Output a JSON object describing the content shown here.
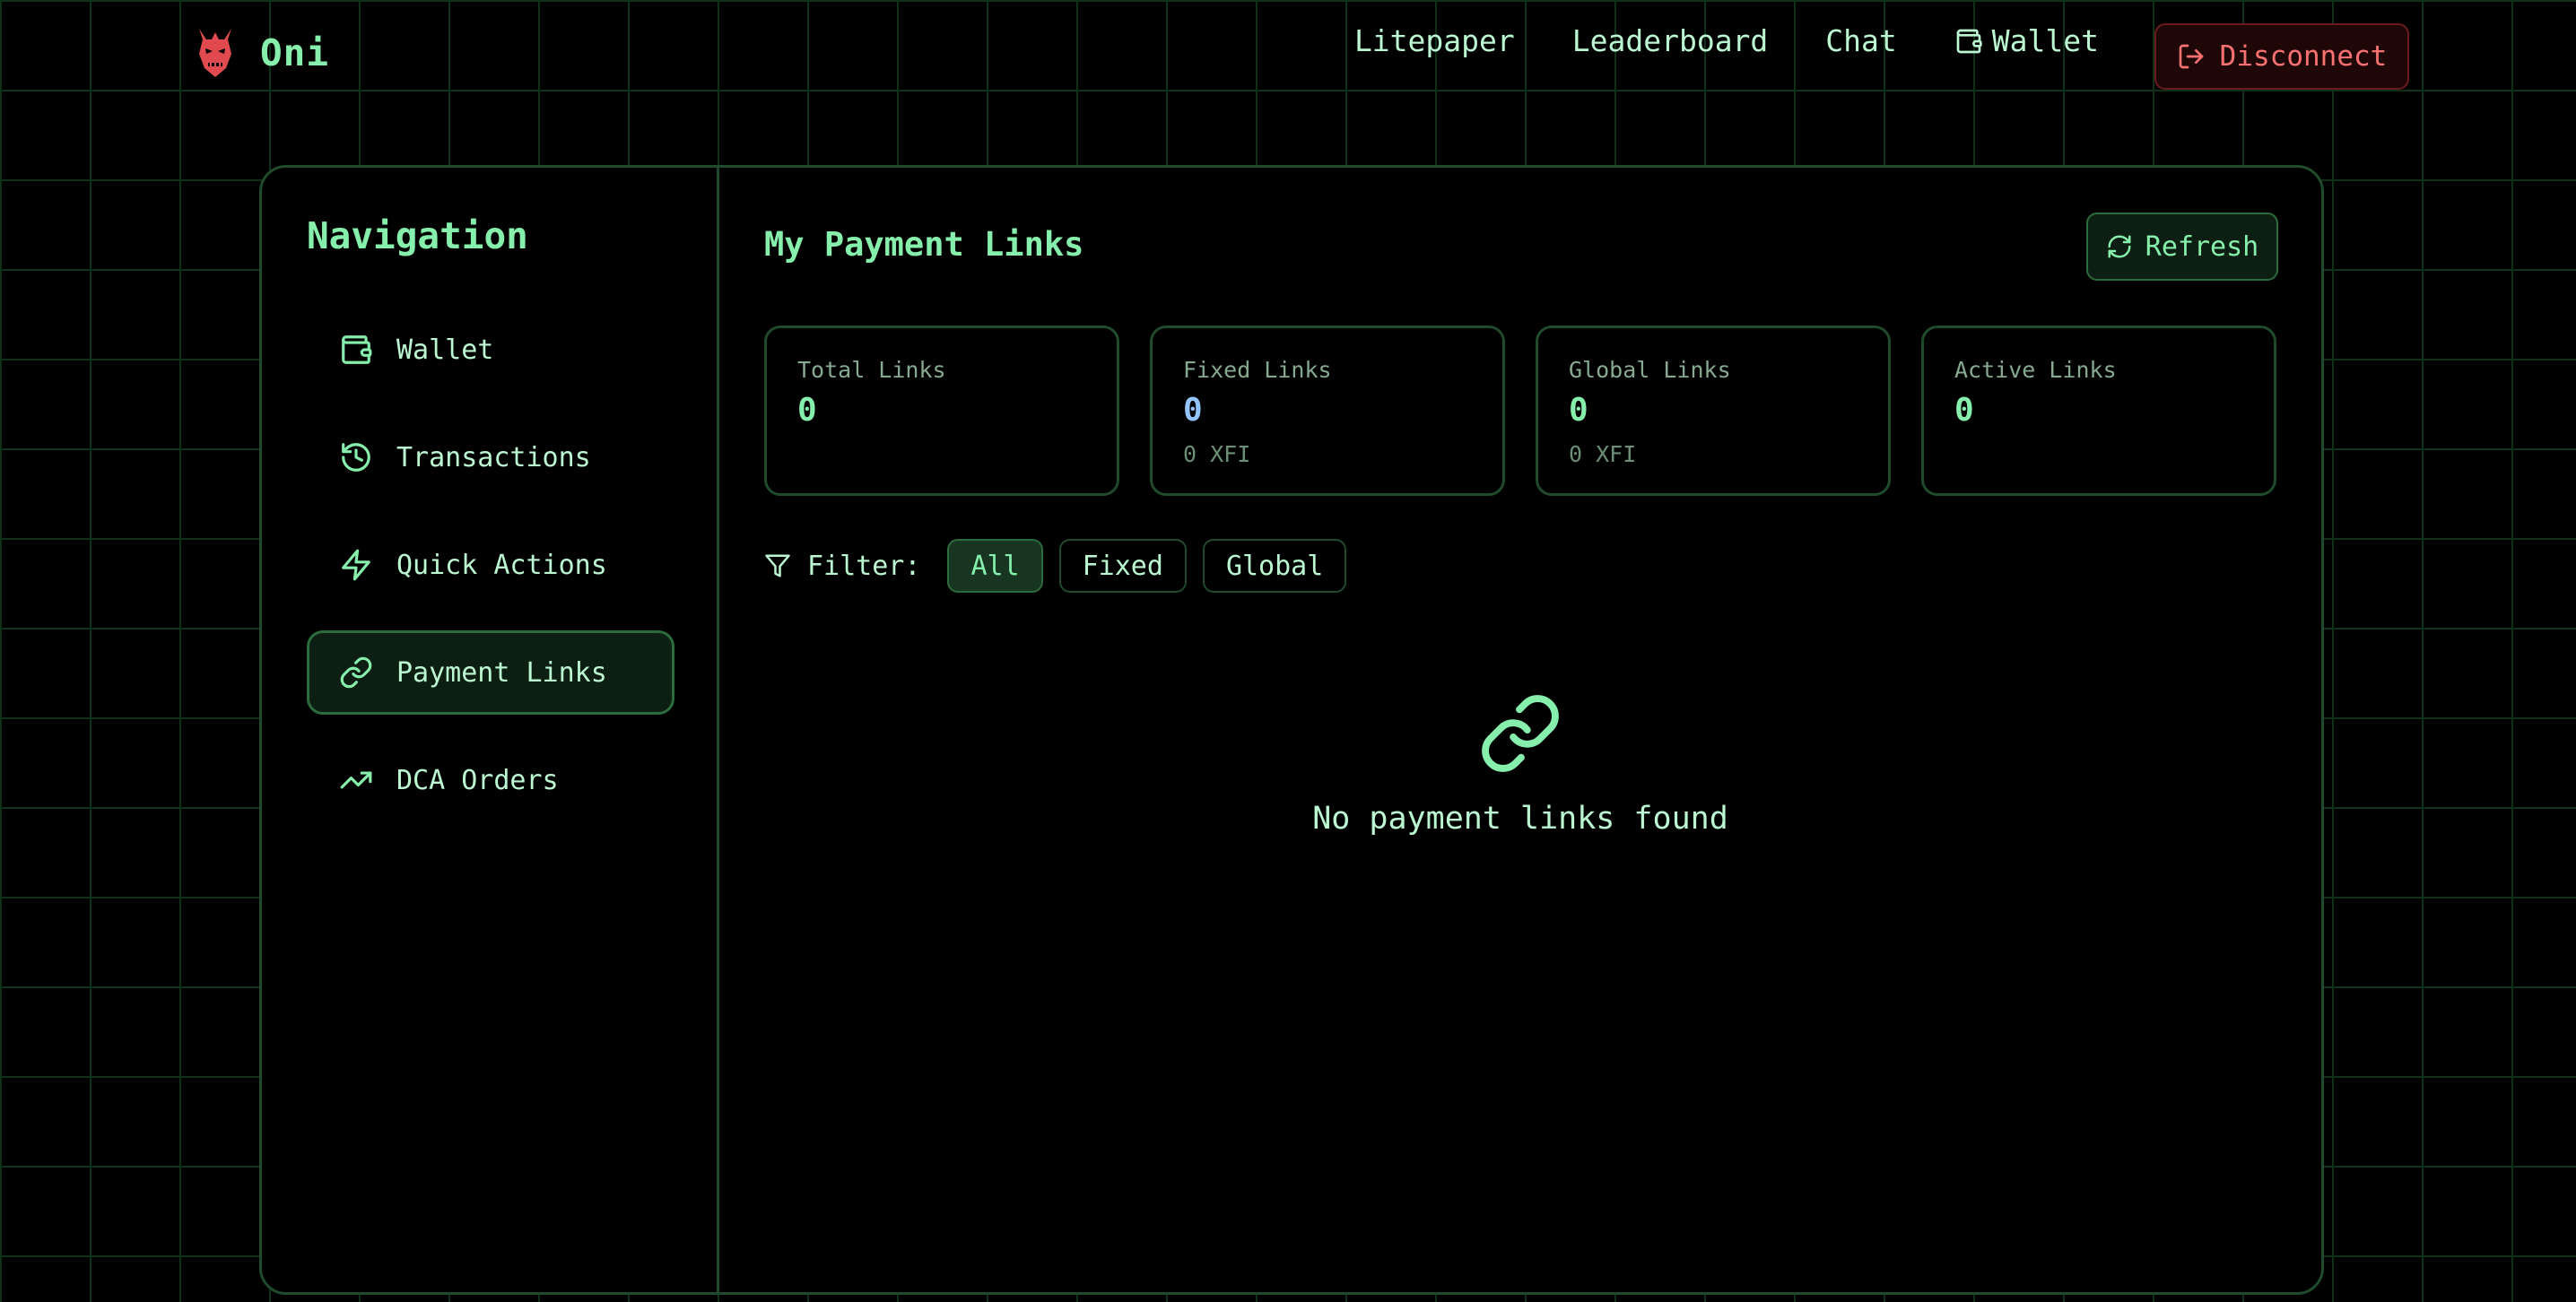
{
  "brand": {
    "name": "Oni",
    "logo_icon": "oni-mask-icon",
    "logo_color": "#e04a4f"
  },
  "topnav": {
    "links": [
      "Litepaper",
      "Leaderboard",
      "Chat"
    ],
    "wallet_label": "Wallet",
    "wallet_icon": "wallet-icon",
    "disconnect_label": "Disconnect",
    "disconnect_icon": "log-out-icon"
  },
  "sidebar": {
    "title": "Navigation",
    "items": [
      {
        "label": "Wallet",
        "icon": "wallet-icon",
        "active": false
      },
      {
        "label": "Transactions",
        "icon": "history-icon",
        "active": false
      },
      {
        "label": "Quick Actions",
        "icon": "lightning-icon",
        "active": false
      },
      {
        "label": "Payment Links",
        "icon": "link-icon",
        "active": true
      },
      {
        "label": "DCA Orders",
        "icon": "trending-up-icon",
        "active": false
      }
    ]
  },
  "main": {
    "title": "My Payment Links",
    "refresh_label": "Refresh",
    "stats": [
      {
        "label": "Total Links",
        "value": "0",
        "sub": ""
      },
      {
        "label": "Fixed Links",
        "value": "0",
        "sub": "0 XFI"
      },
      {
        "label": "Global Links",
        "value": "0",
        "sub": "0 XFI"
      },
      {
        "label": "Active Links",
        "value": "0",
        "sub": ""
      }
    ],
    "filter": {
      "label": "Filter:",
      "options": [
        "All",
        "Fixed",
        "Global"
      ],
      "selected": "All"
    },
    "empty_text": "No payment links found"
  },
  "colors": {
    "accent": "#86efac",
    "text": "#bbf7d0",
    "danger": "#f87171",
    "border": "#1f4a2b",
    "fixed_value": "#93c5fd"
  }
}
